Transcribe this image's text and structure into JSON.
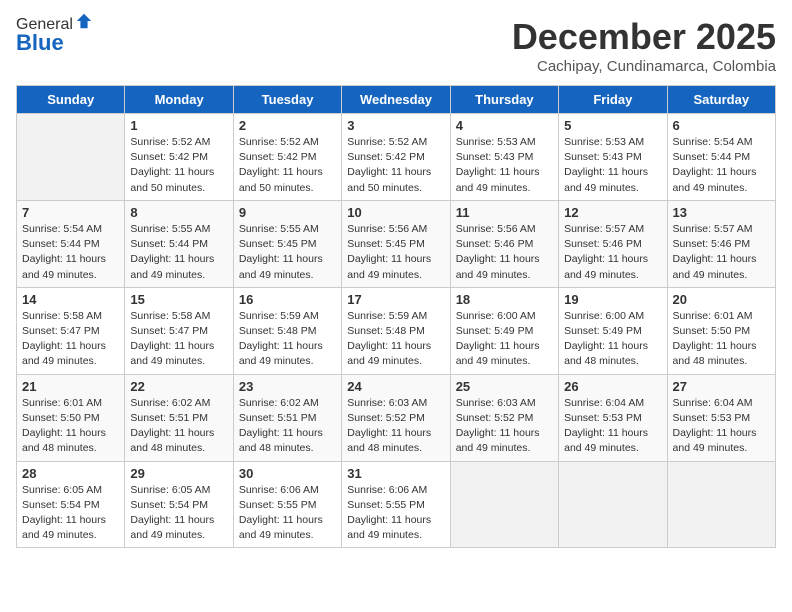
{
  "header": {
    "logo_line1": "General",
    "logo_line2": "Blue",
    "month": "December 2025",
    "location": "Cachipay, Cundinamarca, Colombia"
  },
  "weekdays": [
    "Sunday",
    "Monday",
    "Tuesday",
    "Wednesday",
    "Thursday",
    "Friday",
    "Saturday"
  ],
  "weeks": [
    [
      {
        "day": "",
        "info": ""
      },
      {
        "day": "1",
        "info": "Sunrise: 5:52 AM\nSunset: 5:42 PM\nDaylight: 11 hours\nand 50 minutes."
      },
      {
        "day": "2",
        "info": "Sunrise: 5:52 AM\nSunset: 5:42 PM\nDaylight: 11 hours\nand 50 minutes."
      },
      {
        "day": "3",
        "info": "Sunrise: 5:52 AM\nSunset: 5:42 PM\nDaylight: 11 hours\nand 50 minutes."
      },
      {
        "day": "4",
        "info": "Sunrise: 5:53 AM\nSunset: 5:43 PM\nDaylight: 11 hours\nand 49 minutes."
      },
      {
        "day": "5",
        "info": "Sunrise: 5:53 AM\nSunset: 5:43 PM\nDaylight: 11 hours\nand 49 minutes."
      },
      {
        "day": "6",
        "info": "Sunrise: 5:54 AM\nSunset: 5:44 PM\nDaylight: 11 hours\nand 49 minutes."
      }
    ],
    [
      {
        "day": "7",
        "info": "Sunrise: 5:54 AM\nSunset: 5:44 PM\nDaylight: 11 hours\nand 49 minutes."
      },
      {
        "day": "8",
        "info": "Sunrise: 5:55 AM\nSunset: 5:44 PM\nDaylight: 11 hours\nand 49 minutes."
      },
      {
        "day": "9",
        "info": "Sunrise: 5:55 AM\nSunset: 5:45 PM\nDaylight: 11 hours\nand 49 minutes."
      },
      {
        "day": "10",
        "info": "Sunrise: 5:56 AM\nSunset: 5:45 PM\nDaylight: 11 hours\nand 49 minutes."
      },
      {
        "day": "11",
        "info": "Sunrise: 5:56 AM\nSunset: 5:46 PM\nDaylight: 11 hours\nand 49 minutes."
      },
      {
        "day": "12",
        "info": "Sunrise: 5:57 AM\nSunset: 5:46 PM\nDaylight: 11 hours\nand 49 minutes."
      },
      {
        "day": "13",
        "info": "Sunrise: 5:57 AM\nSunset: 5:46 PM\nDaylight: 11 hours\nand 49 minutes."
      }
    ],
    [
      {
        "day": "14",
        "info": "Sunrise: 5:58 AM\nSunset: 5:47 PM\nDaylight: 11 hours\nand 49 minutes."
      },
      {
        "day": "15",
        "info": "Sunrise: 5:58 AM\nSunset: 5:47 PM\nDaylight: 11 hours\nand 49 minutes."
      },
      {
        "day": "16",
        "info": "Sunrise: 5:59 AM\nSunset: 5:48 PM\nDaylight: 11 hours\nand 49 minutes."
      },
      {
        "day": "17",
        "info": "Sunrise: 5:59 AM\nSunset: 5:48 PM\nDaylight: 11 hours\nand 49 minutes."
      },
      {
        "day": "18",
        "info": "Sunrise: 6:00 AM\nSunset: 5:49 PM\nDaylight: 11 hours\nand 49 minutes."
      },
      {
        "day": "19",
        "info": "Sunrise: 6:00 AM\nSunset: 5:49 PM\nDaylight: 11 hours\nand 48 minutes."
      },
      {
        "day": "20",
        "info": "Sunrise: 6:01 AM\nSunset: 5:50 PM\nDaylight: 11 hours\nand 48 minutes."
      }
    ],
    [
      {
        "day": "21",
        "info": "Sunrise: 6:01 AM\nSunset: 5:50 PM\nDaylight: 11 hours\nand 48 minutes."
      },
      {
        "day": "22",
        "info": "Sunrise: 6:02 AM\nSunset: 5:51 PM\nDaylight: 11 hours\nand 48 minutes."
      },
      {
        "day": "23",
        "info": "Sunrise: 6:02 AM\nSunset: 5:51 PM\nDaylight: 11 hours\nand 48 minutes."
      },
      {
        "day": "24",
        "info": "Sunrise: 6:03 AM\nSunset: 5:52 PM\nDaylight: 11 hours\nand 48 minutes."
      },
      {
        "day": "25",
        "info": "Sunrise: 6:03 AM\nSunset: 5:52 PM\nDaylight: 11 hours\nand 49 minutes."
      },
      {
        "day": "26",
        "info": "Sunrise: 6:04 AM\nSunset: 5:53 PM\nDaylight: 11 hours\nand 49 minutes."
      },
      {
        "day": "27",
        "info": "Sunrise: 6:04 AM\nSunset: 5:53 PM\nDaylight: 11 hours\nand 49 minutes."
      }
    ],
    [
      {
        "day": "28",
        "info": "Sunrise: 6:05 AM\nSunset: 5:54 PM\nDaylight: 11 hours\nand 49 minutes."
      },
      {
        "day": "29",
        "info": "Sunrise: 6:05 AM\nSunset: 5:54 PM\nDaylight: 11 hours\nand 49 minutes."
      },
      {
        "day": "30",
        "info": "Sunrise: 6:06 AM\nSunset: 5:55 PM\nDaylight: 11 hours\nand 49 minutes."
      },
      {
        "day": "31",
        "info": "Sunrise: 6:06 AM\nSunset: 5:55 PM\nDaylight: 11 hours\nand 49 minutes."
      },
      {
        "day": "",
        "info": ""
      },
      {
        "day": "",
        "info": ""
      },
      {
        "day": "",
        "info": ""
      }
    ]
  ]
}
